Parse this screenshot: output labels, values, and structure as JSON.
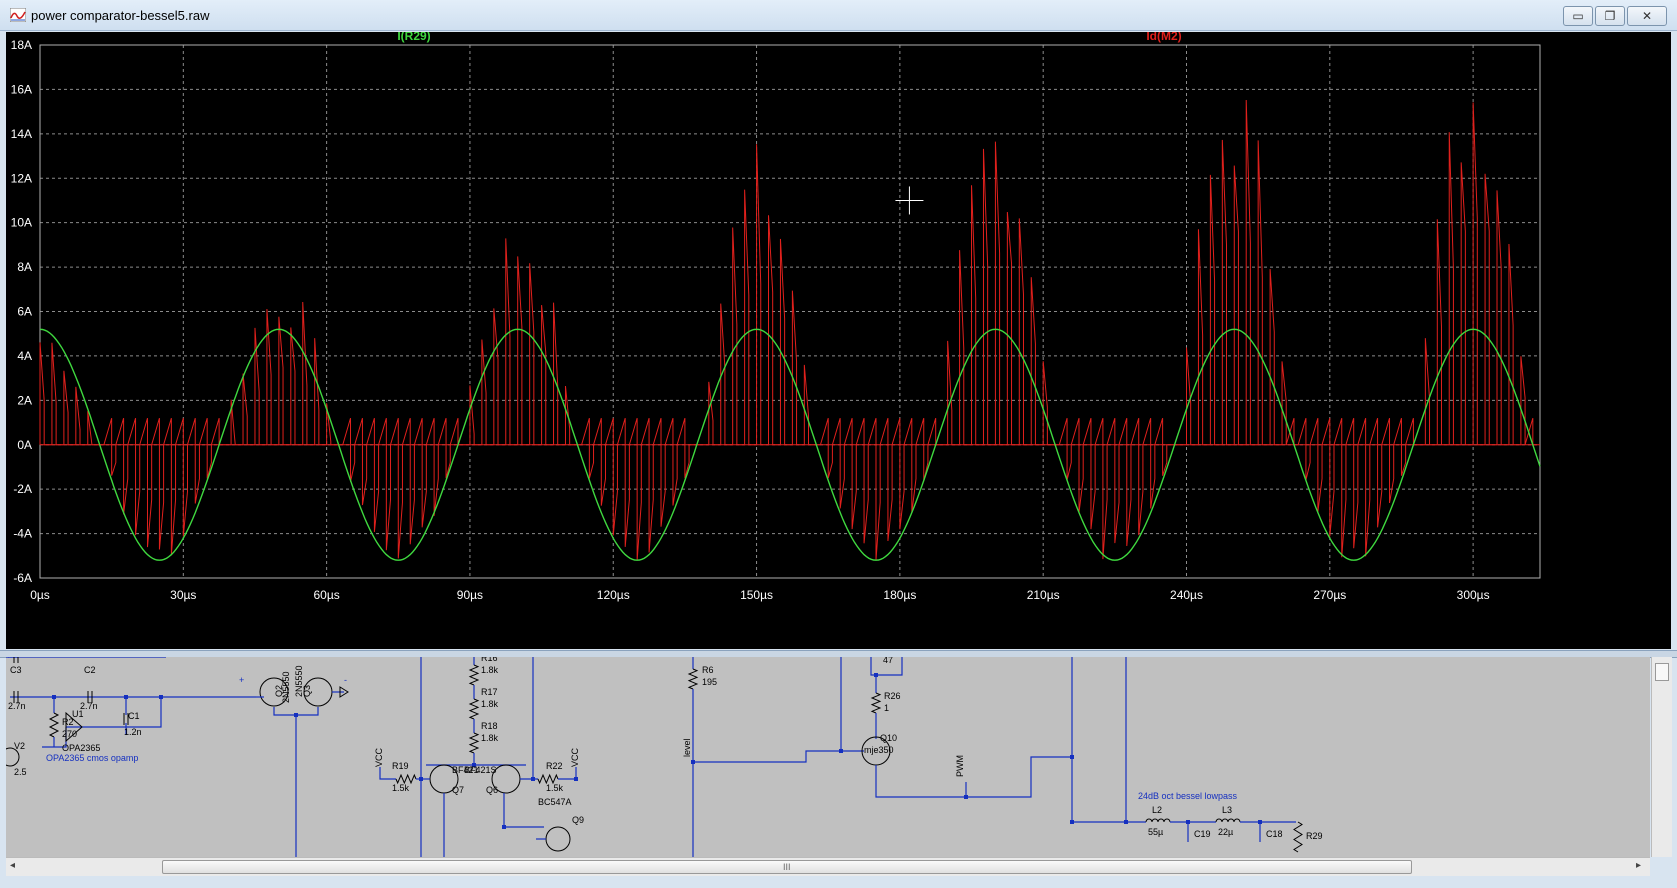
{
  "window": {
    "title": "power comparator-bessel5.raw",
    "minimize_glyph": "▭",
    "restore_glyph": "❐",
    "close_glyph": "✕"
  },
  "colors": {
    "green_trace": "#3fd83f",
    "red_trace": "#e0201c",
    "grid": "#8c8c8c",
    "axis_text": "#ffffff",
    "schematic_wire": "#1530c0"
  },
  "chart_data": {
    "type": "line",
    "x_unit": "µs",
    "y_unit": "A",
    "xlim": [
      0,
      314
    ],
    "ylim": [
      -6,
      18
    ],
    "x_ticks": [
      0,
      30,
      60,
      90,
      120,
      150,
      180,
      210,
      240,
      270,
      300
    ],
    "x_tick_labels": [
      "0µs",
      "30µs",
      "60µs",
      "90µs",
      "120µs",
      "150µs",
      "180µs",
      "210µs",
      "240µs",
      "270µs",
      "300µs"
    ],
    "y_ticks": [
      -6,
      -4,
      -2,
      0,
      2,
      4,
      6,
      8,
      10,
      12,
      14,
      16,
      18
    ],
    "y_tick_labels": [
      "-6A",
      "-4A",
      "-2A",
      "0A",
      "2A",
      "4A",
      "6A",
      "8A",
      "10A",
      "12A",
      "14A",
      "16A",
      "18A"
    ],
    "grid": true,
    "series": [
      {
        "name": "I(R29)",
        "color": "#3fd83f",
        "kind": "sine",
        "amplitude": 5.2,
        "period": 50,
        "phase_peak_at": 0,
        "offset": 0
      },
      {
        "name": "Id(M2)",
        "color": "#e0201c",
        "kind": "pulsed",
        "pulse_period": 2.5,
        "envelope_peaks": [
          {
            "x": 0,
            "y": 5.0
          },
          {
            "x": 48,
            "y": 7.0
          },
          {
            "x": 98,
            "y": 9.6
          },
          {
            "x": 148,
            "y": 12.4
          },
          {
            "x": 198,
            "y": 14.4
          },
          {
            "x": 248,
            "y": 15.8
          },
          {
            "x": 298,
            "y": 16.7
          }
        ],
        "negative_lobe_min": -5.2
      }
    ],
    "crosshair": {
      "x": 182,
      "y": 11.0
    }
  },
  "schematic": {
    "labels": [
      {
        "id": "c3",
        "text": "C3"
      },
      {
        "id": "c3v",
        "text": "2.7n"
      },
      {
        "id": "c2",
        "text": "C2"
      },
      {
        "id": "c2v",
        "text": "2.7n"
      },
      {
        "id": "c1",
        "text": "C1"
      },
      {
        "id": "c1v",
        "text": "1.2n"
      },
      {
        "id": "r2",
        "text": "R2"
      },
      {
        "id": "r2v",
        "text": "270"
      },
      {
        "id": "u1",
        "text": "U1"
      },
      {
        "id": "u1v",
        "text": "OPA2365"
      },
      {
        "id": "v2",
        "text": "V2"
      },
      {
        "id": "v2v",
        "text": "2.5"
      },
      {
        "id": "opcomment",
        "text": "OPA2365 cmos opamp"
      },
      {
        "id": "q2",
        "text": "Q2"
      },
      {
        "id": "q2v",
        "text": "2N5550"
      },
      {
        "id": "q3",
        "text": "Q3"
      },
      {
        "id": "q3v",
        "text": "2N5550"
      },
      {
        "id": "plus",
        "text": "+"
      },
      {
        "id": "minus",
        "text": "-"
      },
      {
        "id": "r16",
        "text": "R16"
      },
      {
        "id": "r16v",
        "text": "1.8k"
      },
      {
        "id": "r17",
        "text": "R17"
      },
      {
        "id": "r17v",
        "text": "1.8k"
      },
      {
        "id": "r18",
        "text": "R18"
      },
      {
        "id": "r18v",
        "text": "1.8k"
      },
      {
        "id": "vcc1",
        "text": "VCC"
      },
      {
        "id": "r19",
        "text": "R19"
      },
      {
        "id": "r19v",
        "text": "1.5k"
      },
      {
        "id": "q7",
        "text": "Q7"
      },
      {
        "id": "q7v",
        "text": "BF421"
      },
      {
        "id": "q6",
        "text": "Q6"
      },
      {
        "id": "q6v",
        "text": "BF421S"
      },
      {
        "id": "r22",
        "text": "R22"
      },
      {
        "id": "r22v",
        "text": "1.5k"
      },
      {
        "id": "vcc2",
        "text": "VCC"
      },
      {
        "id": "bc",
        "text": "BC547A"
      },
      {
        "id": "q9",
        "text": "Q9"
      },
      {
        "id": "r6",
        "text": "R6"
      },
      {
        "id": "r6v",
        "text": "195"
      },
      {
        "id": "level",
        "text": "level"
      },
      {
        "id": "r47",
        "text": "47"
      },
      {
        "id": "r26",
        "text": "R26"
      },
      {
        "id": "r26v",
        "text": "1"
      },
      {
        "id": "q10",
        "text": "Q10"
      },
      {
        "id": "q10v",
        "text": "mje350"
      },
      {
        "id": "pwm",
        "text": "PWM"
      },
      {
        "id": "bessel",
        "text": "24dB oct bessel lowpass"
      },
      {
        "id": "l2",
        "text": "L2"
      },
      {
        "id": "l2v",
        "text": "55µ"
      },
      {
        "id": "c19",
        "text": "C19"
      },
      {
        "id": "l3",
        "text": "L3"
      },
      {
        "id": "l3v",
        "text": "22µ"
      },
      {
        "id": "c18",
        "text": "C18"
      },
      {
        "id": "r29",
        "text": "R29"
      }
    ]
  },
  "scrollbars": {
    "left_arrow": "◂",
    "right_arrow": "▸",
    "grip": "III"
  }
}
